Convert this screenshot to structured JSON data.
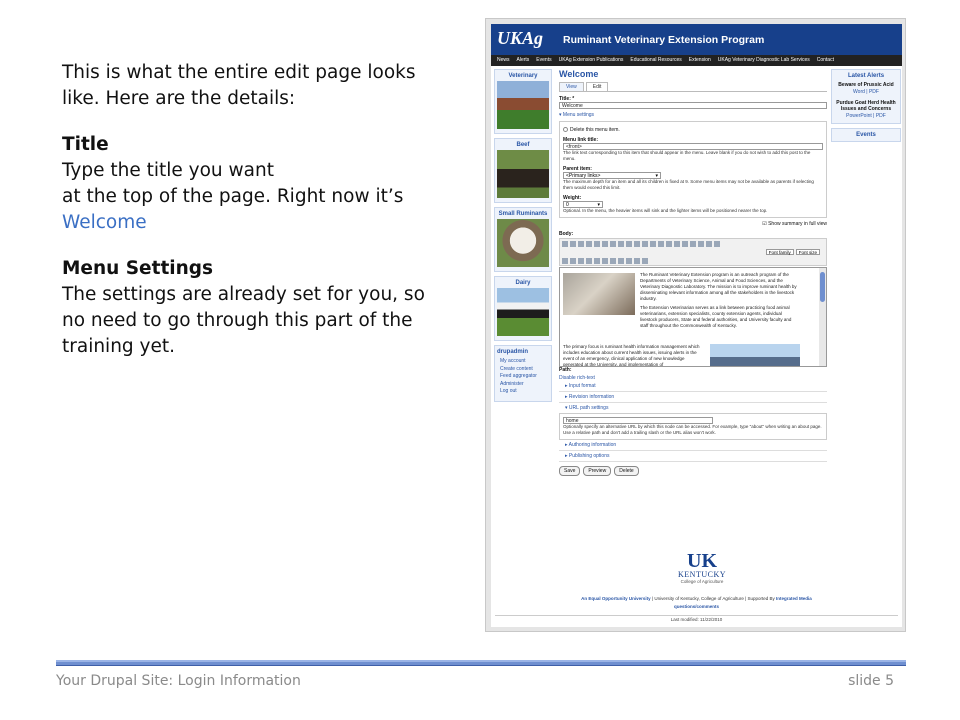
{
  "notes": {
    "intro_line1": "This is what the entire edit page looks",
    "intro_line2": "like. Here are the details:",
    "title_heading": "Title",
    "title_line1": "Type the title you want",
    "title_line2": "at the top of the page. Right now it’s",
    "title_value": "Welcome",
    "menu_heading": "Menu Settings",
    "menu_line1": "The settings are already set for you, so",
    "menu_line2": "no need to go through this part of the",
    "menu_line3": "training yet."
  },
  "footer": {
    "left": "Your Drupal Site: Login Information",
    "right": "slide 5",
    "line_color": "#6f8fd0"
  },
  "site": {
    "logo": "UKAg",
    "title": "Ruminant Veterinary Extension Program",
    "brand_color": "#17408b",
    "nav": [
      "News",
      "Alerts",
      "Events",
      "UKAg Extension Publications",
      "Educational Resources",
      "Extension",
      "UKAg Veterinary Diagnostic Lab Services",
      "Contact"
    ],
    "left_boxes": [
      "Veterinary",
      "Beef",
      "Small Ruminants",
      "Dairy"
    ],
    "admin": {
      "title": "drupadmin",
      "links": [
        "My account",
        "Create content",
        "Feed aggregator",
        "Administer",
        "Log out"
      ]
    },
    "right": {
      "alerts_title": "Latest Alerts",
      "alert1": "Beware of Prussic Acid",
      "alert1_links": "Word | PDF",
      "alert2": "Purdue Goat Herd Health Issues and Concerns",
      "alert2_links": "PowerPoint | PDF",
      "events_title": "Events"
    },
    "page_title": "Welcome",
    "tabs": [
      "View",
      "Edit"
    ],
    "title_label": "Title: *",
    "title_value": "Welcome",
    "menu_settings_legend": "▾ Menu settings",
    "delete_item": "Delete this menu item.",
    "menu_link_title_label": "Menu link title:",
    "menu_link_title_value": "<front>",
    "menu_link_desc": "The link text corresponding to this item that should appear in the menu. Leave blank if you do not wish to add this post to the menu.",
    "parent_label": "Parent item:",
    "parent_value": "<Primary links>",
    "parent_desc": "The maximum depth for an item and all its children is fixed at 9. Some menu items may not be available as parents if selecting them would exceed this limit.",
    "weight_label": "Weight:",
    "weight_value": "0",
    "weight_desc": "Optional. In the menu, the heavier items will sink and the lighter items will be positioned nearer the top.",
    "show_summary": "Show summary in full view",
    "body_label": "Body:",
    "font_family": "Font family",
    "font_size": "Font size",
    "body_text1": "The Ruminant Veterinary Extension program is an outreach program of the Departments of Veterinary Science, Animal and Food Sciences, and the Veterinary Diagnostic Laboratory. The mission is to improve ruminant health by disseminating relevant information among all the stakeholders in the livestock industry.",
    "body_text2": "The Extension Veterinarian serves as a link between practicing food animal veterinarians, extension specialists, county extension agents, individual livestock producers, State and federal authorities, and University faculty and staff throughout the Commonwealth of Kentucky.",
    "body_text3": "The primary focus is ruminant health information management which includes education about current health issues, issuing alerts in the event of an emergency, clinical application of new knowledge generated at the University, and implementation of",
    "path_label": "Path:",
    "disable_rich": "Disable rich-text",
    "input_format": "▸ Input format",
    "revision_info": "▸ Revision information",
    "url_path_legend": "▾ URL path settings",
    "url_path_value": "home",
    "url_path_desc": "Optionally specify an alternative URL by which this node can be accessed. For example, type \"about\" when writing an about page. Use a relative path and don't add a trailing slash or the URL alias won't work.",
    "authoring_info": "▸ Authoring information",
    "publishing_options": "▸ Publishing options",
    "buttons": [
      "Save",
      "Preview",
      "Delete"
    ],
    "uk_logo": "UK",
    "uk_kentucky": "KENTUCKY",
    "uk_college": "College of Agriculture",
    "footer_eo": "An Equal Opportunity University",
    "footer_mid": "| University of Kentucky, College of Agriculture | Supported By",
    "footer_im": "Integrated Media",
    "footer_qc": "questions/comments",
    "last_modified": "Last modified: 11/22/2010"
  }
}
